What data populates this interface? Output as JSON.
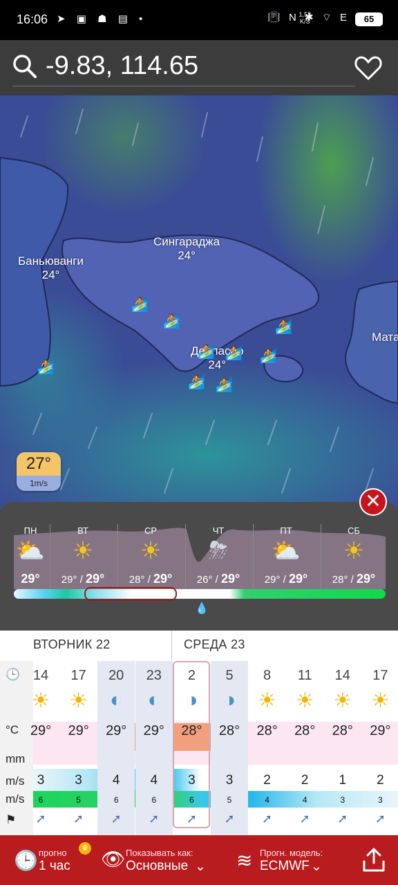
{
  "status": {
    "time": "16:06",
    "left_icons": "➤ ▣ ☗ ▤ •",
    "net_speed": "1,53",
    "net_unit": "K/S",
    "right_icons": "📳 N ✱ ⌔ E",
    "battery": "65"
  },
  "search": {
    "text": "-9.83, 114.65"
  },
  "map": {
    "cities": [
      {
        "name": "Сингараджа",
        "temp": "24°"
      },
      {
        "name": "Баньюванги",
        "temp": "24°"
      },
      {
        "name": "Денпасар",
        "temp": "24°"
      },
      {
        "name": "Мата",
        "temp": ""
      }
    ],
    "badge_temp": "27°",
    "badge_wind": "1m/s"
  },
  "forecast": {
    "days": [
      {
        "name": "ПН",
        "icon": "sun-cloud",
        "min": "",
        "max": "29°"
      },
      {
        "name": "ВТ",
        "icon": "sun",
        "min": "29°",
        "max": "29°"
      },
      {
        "name": "СР",
        "icon": "sun",
        "min": "28°",
        "max": "29°"
      },
      {
        "name": "ЧТ",
        "icon": "storm",
        "min": "26°",
        "max": "29°"
      },
      {
        "name": "ПТ",
        "icon": "sun-cloud",
        "min": "29°",
        "max": "29°"
      },
      {
        "name": "СБ",
        "icon": "sun",
        "min": "28°",
        "max": "29°"
      }
    ],
    "separator": " / "
  },
  "table": {
    "day1": "ВТОРНИК 22",
    "day2": "СРЕДА 23",
    "row_labels": {
      "temp": "°C",
      "rain": "mm",
      "wind": "m/s",
      "gust": "m/s"
    },
    "hours": [
      "14",
      "17",
      "20",
      "23",
      "2",
      "5",
      "8",
      "11",
      "14",
      "17"
    ],
    "temps": [
      "29°",
      "29°",
      "29°",
      "29°",
      "28°",
      "28°",
      "28°",
      "28°",
      "28°",
      "29°"
    ],
    "wind": [
      "3",
      "3",
      "4",
      "4",
      "3",
      "3",
      "2",
      "2",
      "1",
      "2"
    ],
    "gusts": [
      "6",
      "5",
      "6",
      "6",
      "6",
      "5",
      "4",
      "4",
      "3",
      "3"
    ]
  },
  "bottom": {
    "forecast_small": "прогно",
    "forecast_big": "1 час",
    "show_small": "Показывать как:",
    "show_big": "Основные",
    "model_small": "Прогн. модель:",
    "model_big": "ECMWF"
  },
  "colors": {
    "brand_red": "#b81c1e",
    "close_red": "#c4161c",
    "sun": "#f6b400"
  }
}
